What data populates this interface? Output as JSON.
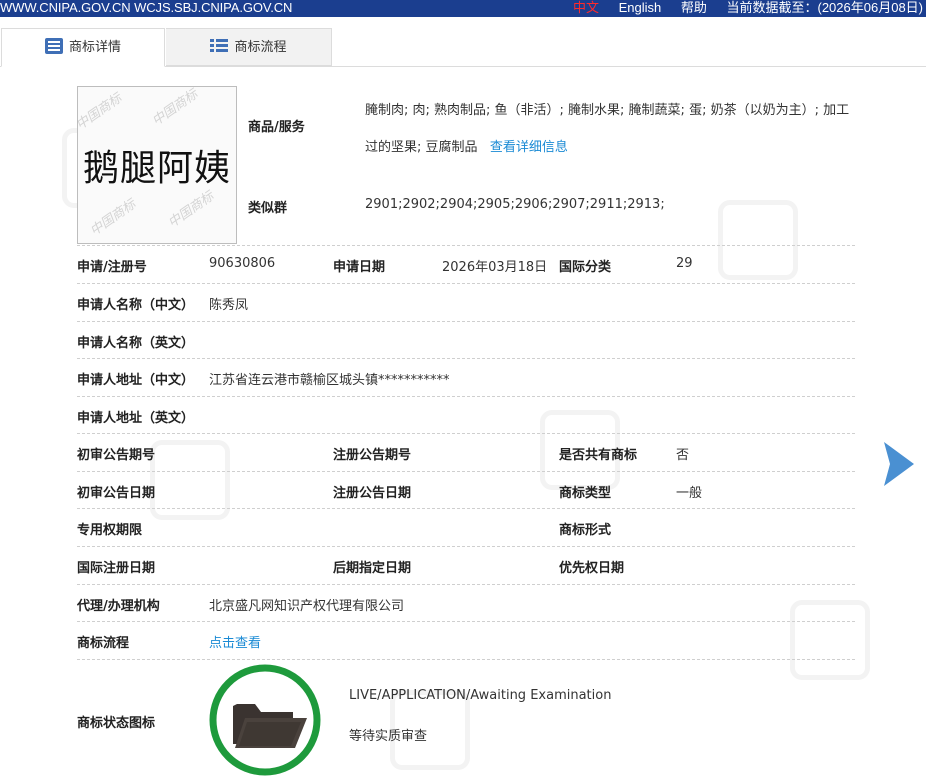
{
  "topbar": {
    "url": "WWW.CNIPA.GOV.CN WCJS.SBJ.CNIPA.GOV.CN",
    "lang_zh": "中文",
    "lang_en": "English",
    "help": "帮助",
    "as_of": "当前数据截至：(2026年06月08日)"
  },
  "tabs": {
    "detail": "商标详情",
    "process": "商标流程"
  },
  "mark": {
    "text": "鹅腿阿姨"
  },
  "goods": {
    "label": "商品/服务",
    "text": "腌制肉; 肉; 熟肉制品; 鱼（非活）; 腌制水果; 腌制蔬菜; 蛋; 奶茶（以奶为主）; 加工过的坚果; 豆腐制品",
    "more": "查看详细信息"
  },
  "similar": {
    "label": "类似群",
    "value": "2901;2902;2904;2905;2906;2907;2911;2913;"
  },
  "fields": {
    "reg_no_label": "申请/注册号",
    "reg_no": "90630806",
    "app_date_label": "申请日期",
    "app_date": "2026年03月18日",
    "intl_class_label": "国际分类",
    "intl_class": "29",
    "applicant_cn_label": "申请人名称（中文）",
    "applicant_cn": "陈秀凤",
    "applicant_en_label": "申请人名称（英文）",
    "address_cn_label": "申请人地址（中文）",
    "address_cn": "江苏省连云港市赣榆区城头镇***********",
    "address_en_label": "申请人地址（英文）",
    "prelim_no_label": "初审公告期号",
    "reg_pub_no_label": "注册公告期号",
    "shared_label": "是否共有商标",
    "shared": "否",
    "prelim_date_label": "初审公告日期",
    "reg_pub_date_label": "注册公告日期",
    "mark_type_label": "商标类型",
    "mark_type": "一般",
    "exclusive_label": "专用权期限",
    "mark_form_label": "商标形式",
    "intl_reg_date_label": "国际注册日期",
    "later_desig_label": "后期指定日期",
    "priority_label": "优先权日期",
    "agent_label": "代理/办理机构",
    "agent": "北京盛凡网知识产权代理有限公司",
    "process_label": "商标流程",
    "process_link": "点击查看",
    "status_icon_label": "商标状态图标",
    "status_en": "LIVE/APPLICATION/Awaiting Examination",
    "status_cn": "等待实质审查"
  },
  "colors": {
    "topbar": "#1b3e8f",
    "link": "#1a8ad4",
    "status_ring": "#1e9a3c",
    "arrow": "#4a90d2"
  },
  "icons": {
    "tab_detail": "list-lines-icon",
    "tab_process": "list-grid-icon",
    "status": "folder-icon",
    "next": "chevron-right-icon"
  }
}
